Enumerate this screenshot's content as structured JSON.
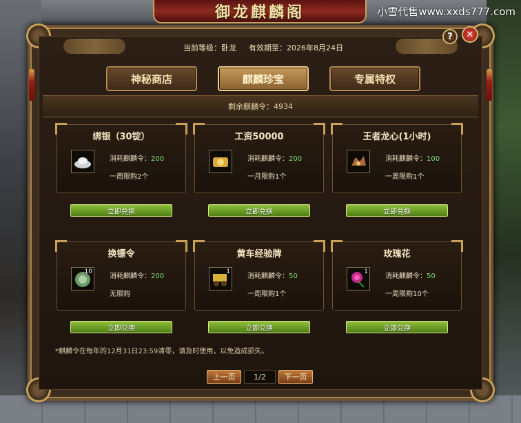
{
  "watermark": "小雪代售www.xxds777.com",
  "title": "御龙麒麟阁",
  "header": {
    "level_label": "当前等级：卧龙",
    "expiry_label": "有效期至：2026年8月24日"
  },
  "tabs": [
    {
      "label": "神秘商店"
    },
    {
      "label": "麒麟珍宝"
    },
    {
      "label": "专属特权"
    }
  ],
  "remaining": "剩余麒麟令：4934",
  "cost_prefix": "消耗麒麟令：",
  "redeem_label": "立即兑换",
  "items": [
    {
      "name": "绑银（30锭）",
      "cost": "200",
      "limit": "一周限购2个",
      "icon": "silver-ingot-icon",
      "count": ""
    },
    {
      "name": "工资50000",
      "cost": "200",
      "limit": "一月限购1个",
      "icon": "gold-wage-icon",
      "count": ""
    },
    {
      "name": "王者龙心(1小时)",
      "cost": "100",
      "limit": "一周限购1个",
      "icon": "dragon-heart-icon",
      "count": ""
    },
    {
      "name": "换镖令",
      "cost": "200",
      "limit": "无限购",
      "icon": "escort-token-icon",
      "count": "10"
    },
    {
      "name": "黄车经验牌",
      "cost": "50",
      "limit": "一周限购1个",
      "icon": "yellow-cart-icon",
      "count": "1"
    },
    {
      "name": "玫瑰花",
      "cost": "50",
      "limit": "一周限购10个",
      "icon": "rose-icon",
      "count": "1"
    }
  ],
  "note": "*麒麟令在每年的12月31日23:59清零，请及时使用，以免造成损失。",
  "pager": {
    "prev": "上一页",
    "page": "1/2",
    "next": "下一页"
  },
  "help_label": "?",
  "close_label": "✕"
}
